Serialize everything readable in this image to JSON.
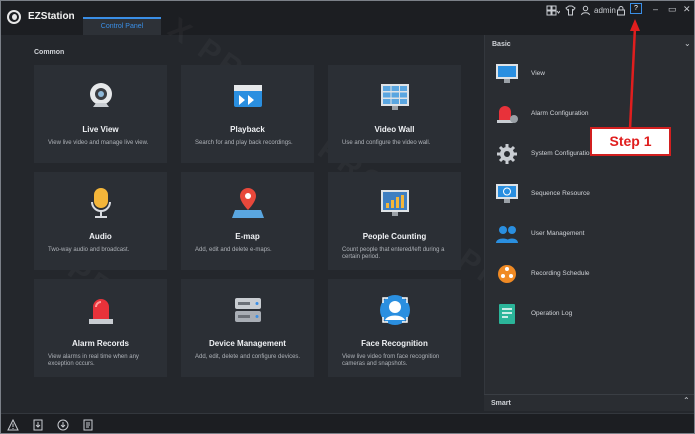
{
  "app": {
    "title": "EZStation",
    "active_tab": "Control Panel"
  },
  "topbar": {
    "user": "admin"
  },
  "main": {
    "section_label": "Common",
    "cards": [
      {
        "name": "Live View",
        "desc": "View live video and manage live view.",
        "icon": "camera-icon"
      },
      {
        "name": "Playback",
        "desc": "Search for and play back recordings.",
        "icon": "playback-icon"
      },
      {
        "name": "Video Wall",
        "desc": "Use and configure the video wall.",
        "icon": "video-wall-icon"
      },
      {
        "name": "Audio",
        "desc": "Two-way audio and broadcast.",
        "icon": "microphone-icon"
      },
      {
        "name": "E-map",
        "desc": "Add, edit and delete e-maps.",
        "icon": "map-pin-icon"
      },
      {
        "name": "People Counting",
        "desc": "Count people that entered/left during a certain period.",
        "icon": "chart-icon"
      },
      {
        "name": "Alarm Records",
        "desc": "View alarms in real time when any exception occurs.",
        "icon": "alarm-light-icon"
      },
      {
        "name": "Device Management",
        "desc": "Add, edit, delete and configure devices.",
        "icon": "server-icon"
      },
      {
        "name": "Face Recognition",
        "desc": "View live video from face recognition cameras and snapshots.",
        "icon": "face-icon"
      }
    ]
  },
  "right_panel": {
    "basic_label": "Basic",
    "smart_label": "Smart",
    "items": [
      {
        "label": "View",
        "icon": "monitor-icon"
      },
      {
        "label": "Alarm Configuration",
        "icon": "alarm-config-icon"
      },
      {
        "label": "System Configuration",
        "icon": "gear-icon"
      },
      {
        "label": "Sequence Resource",
        "icon": "sequence-icon"
      },
      {
        "label": "User Management",
        "icon": "users-icon"
      },
      {
        "label": "Recording Schedule",
        "icon": "schedule-icon"
      },
      {
        "label": "Operation Log",
        "icon": "log-icon"
      }
    ]
  },
  "annotation": {
    "label": "Step 1"
  },
  "colors": {
    "accent": "#3a8ee6",
    "annotation": "#e01e1e",
    "background": "#24272c",
    "card": "#2b2f35"
  }
}
